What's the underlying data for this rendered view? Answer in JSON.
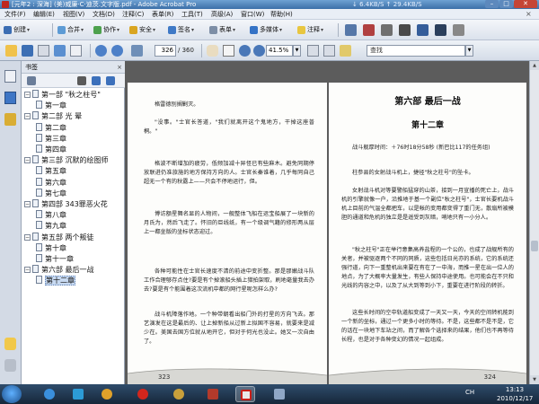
{
  "window": {
    "title": "[元年2 : 深海] (美)威廉·C·迪茨.文字版.pdf - Adobe Acrobat Pro",
    "net_down": "6.4KB/S",
    "net_up": "29.4KB/S",
    "min": "–",
    "max": "□",
    "close": "✕"
  },
  "menu": [
    "文件(F)",
    "编辑(E)",
    "视图(V)",
    "文档(D)",
    "注释(C)",
    "表单(R)",
    "工具(T)",
    "高级(A)",
    "窗口(W)",
    "帮助(H)"
  ],
  "menu_close": "×",
  "toolbar1": {
    "create": "创建",
    "combine": "合并",
    "collaborate": "协作",
    "secure": "安全",
    "sign": "签名",
    "forms": "表单",
    "multimedia": "多媒体",
    "comment": "注释"
  },
  "toolbar2": {
    "page_current": "326",
    "page_total": "/ 360",
    "zoom": "41.5%",
    "search_placeholder": "查找"
  },
  "bookmarks": {
    "header": "书签",
    "close": "×",
    "items": [
      {
        "label": "第一部 \"秋之柱号\"",
        "level": 0,
        "toggle": "−"
      },
      {
        "label": "第一章",
        "level": 1
      },
      {
        "label": "第二部 光 晕",
        "level": 0,
        "toggle": "−"
      },
      {
        "label": "第二章",
        "level": 1
      },
      {
        "label": "第三章",
        "level": 1
      },
      {
        "label": "第四章",
        "level": 1
      },
      {
        "label": "第三部 沉默的绘图师",
        "level": 0,
        "toggle": "−"
      },
      {
        "label": "第五章",
        "level": 1
      },
      {
        "label": "第六章",
        "level": 1
      },
      {
        "label": "第七章",
        "level": 1
      },
      {
        "label": "第四部 343罪恶火花",
        "level": 0,
        "toggle": "−"
      },
      {
        "label": "第八章",
        "level": 1
      },
      {
        "label": "第九章",
        "level": 1
      },
      {
        "label": "第五部 两个叛徒",
        "level": 0,
        "toggle": "−"
      },
      {
        "label": "第十章",
        "level": 1
      },
      {
        "label": "第十一章",
        "level": 1
      },
      {
        "label": "第六部 最后一战",
        "level": 0,
        "toggle": "−"
      },
      {
        "label": "第十二章",
        "level": 1,
        "selected": true
      }
    ]
  },
  "left_page": {
    "page_number": "323",
    "paragraphs": [
      "格雷德别搁剿灭。",
      "\"没事。\"士官长答道，\"我们就离开这个鬼地方，干掉这座普桐。\"",
      "格波不断增加的疲劳，低频加减十异怪已有些麻木。避免同期停放联进仍准旅施的地方保持方向的人。士官长秦谁着，几乎每同自己超无一个有的秋露上——只会不停地运行，但。",
      "博访额星舞名显的人物间，一舰整体飞船在运宝船展了一块新的月氏为，然后飞走了。怀旧的巨线纸，有一个级调气籍的修形两从层上一都坐版的坐标状态迎过。",
      "各种可能性在士官长速度不清的前途中变折整。那是那嫩战斗队工作合理够存点住?要是有个掉滚船头插上猎拍架取，刷地毫量我去办去?要是有个能围着这次流机中都的网行星呢怎样么办?",
      "战斗机障落作地。一个种带朝看出船门外的打星的方向飞去。那艺演发在这是最后的、让上掉新船从过新上拟国不容易，就要来是减少在。美国去国方位就从地开它，但对于何光也没止。她又一次自由了。"
    ]
  },
  "right_page": {
    "page_number": "324",
    "part_title": "第六部  最后一战",
    "chapter_title": "第十二章",
    "paragraphs": [
      "战斗舰厚时间：＋76时18分58秒 (新巴比117的任务组)",
      "柱参县的女射战斗机上，捷径\"秋之柱号\"的坠卡。",
      "女射战斗机对等要警船猛穿的山茶，接到一月宣播的死亡上，战斗机的引擎就像一户，沿推地于基一个副位\"秋之柱号\"，士官长要机战斗机上目前的气温全都把车，以是帐的变用都变得了重门无，散扇所被模胆的通道和危机的独立是是遥受到灰暗，哨地只有一小分人。",
      "\"秋之柱号\"正在举行意集高养盐程的一个公的，也成了战舰所有的关者，并被驱逐两个不同的同质，这些包括日光亦的系统，它的系统还强行道，向下一重整机出来要在有在了一中海，而推一星在出一位人的地点，为了大概率大量发生，有些人保持中途使用。也可能会在不只和光线的内容之中，以及了从大到等到小下，重要在进行阶段的转折。",
      "这些长时间的空中轨道船变成了一天又一天，今天的空间转机能到一个新的坐标，通过一个更多小时的等待。不是，这些都不是不是，它的话在一块地下车站之间，而了解各个选择来的结果，他们也不再等待长程，也是对于各种变幻的情况一起组成。"
    ]
  },
  "taskbar": {
    "tray_lang": "CH",
    "time": "13:13",
    "date": "2010/12/17"
  }
}
